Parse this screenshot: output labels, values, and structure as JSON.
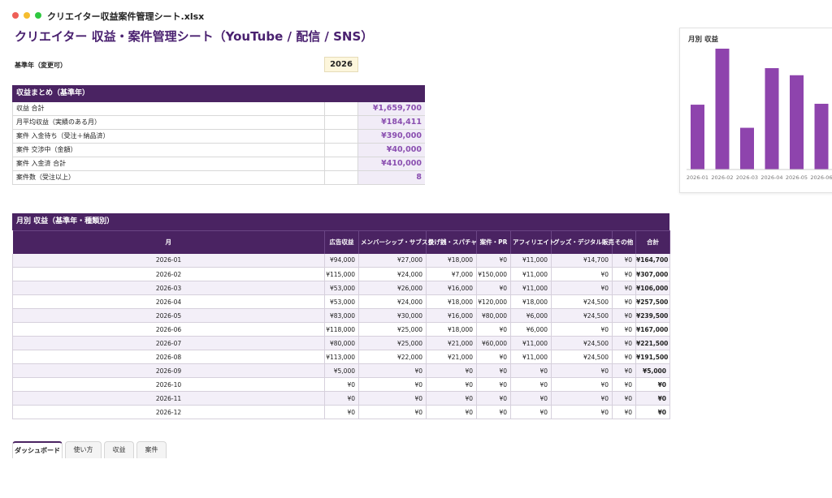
{
  "window": {
    "filename": "クリエイター収益案件管理シート.xlsx"
  },
  "page_title": "クリエイター 収益・案件管理シート（YouTube / 配信 / SNS）",
  "base_year": {
    "label": "基準年（変更可）",
    "value": "2026"
  },
  "summary": {
    "header": "収益まとめ（基準年）",
    "rows": [
      {
        "label": "収益 合計",
        "value": "¥1,659,700"
      },
      {
        "label": "月平均収益（実績のある月）",
        "value": "¥184,411"
      },
      {
        "label": "案件 入金待ち（受注＋納品済）",
        "value": "¥390,000"
      },
      {
        "label": "案件 交渉中（金額）",
        "value": "¥40,000"
      },
      {
        "label": "案件 入金済 合計",
        "value": "¥410,000"
      },
      {
        "label": "案件数（受注以上）",
        "value": "8"
      }
    ]
  },
  "monthly": {
    "header": "月別 収益（基準年・種類別）",
    "columns": [
      "月",
      "広告収益",
      "メンバーシップ・サブスク",
      "投げ銭・スパチャ",
      "案件・PR",
      "アフィリエイト",
      "グッズ・デジタル販売",
      "その他",
      "合計"
    ],
    "rows": [
      [
        "2026-01",
        "¥94,000",
        "¥27,000",
        "¥18,000",
        "¥0",
        "¥11,000",
        "¥14,700",
        "¥0",
        "¥164,700"
      ],
      [
        "2026-02",
        "¥115,000",
        "¥24,000",
        "¥7,000",
        "¥150,000",
        "¥11,000",
        "¥0",
        "¥0",
        "¥307,000"
      ],
      [
        "2026-03",
        "¥53,000",
        "¥26,000",
        "¥16,000",
        "¥0",
        "¥11,000",
        "¥0",
        "¥0",
        "¥106,000"
      ],
      [
        "2026-04",
        "¥53,000",
        "¥24,000",
        "¥18,000",
        "¥120,000",
        "¥18,000",
        "¥24,500",
        "¥0",
        "¥257,500"
      ],
      [
        "2026-05",
        "¥83,000",
        "¥30,000",
        "¥16,000",
        "¥80,000",
        "¥6,000",
        "¥24,500",
        "¥0",
        "¥239,500"
      ],
      [
        "2026-06",
        "¥118,000",
        "¥25,000",
        "¥18,000",
        "¥0",
        "¥6,000",
        "¥0",
        "¥0",
        "¥167,000"
      ],
      [
        "2026-07",
        "¥80,000",
        "¥25,000",
        "¥21,000",
        "¥60,000",
        "¥11,000",
        "¥24,500",
        "¥0",
        "¥221,500"
      ],
      [
        "2026-08",
        "¥113,000",
        "¥22,000",
        "¥21,000",
        "¥0",
        "¥11,000",
        "¥24,500",
        "¥0",
        "¥191,500"
      ],
      [
        "2026-09",
        "¥5,000",
        "¥0",
        "¥0",
        "¥0",
        "¥0",
        "¥0",
        "¥0",
        "¥5,000"
      ],
      [
        "2026-10",
        "¥0",
        "¥0",
        "¥0",
        "¥0",
        "¥0",
        "¥0",
        "¥0",
        "¥0"
      ],
      [
        "2026-11",
        "¥0",
        "¥0",
        "¥0",
        "¥0",
        "¥0",
        "¥0",
        "¥0",
        "¥0"
      ],
      [
        "2026-12",
        "¥0",
        "¥0",
        "¥0",
        "¥0",
        "¥0",
        "¥0",
        "¥0",
        "¥0"
      ]
    ]
  },
  "chart_data": {
    "type": "bar",
    "title": "月別 収益",
    "xlabel": "",
    "ylabel": "",
    "categories": [
      "2026-01",
      "2026-02",
      "2026-03",
      "2026-04",
      "2026-05",
      "2026-06"
    ],
    "values": [
      164700,
      307000,
      106000,
      257500,
      239500,
      167000
    ],
    "ylim": [
      0,
      307000
    ],
    "grid": false,
    "color": "#8e44ad"
  },
  "tabs": [
    {
      "label": "ダッシュボード",
      "active": true
    },
    {
      "label": "使い方",
      "active": false
    },
    {
      "label": "収益",
      "active": false
    },
    {
      "label": "案件",
      "active": false
    }
  ],
  "colors": {
    "header_bg": "#4a2362",
    "title": "#4a2170",
    "value": "#8a4fb0",
    "bar": "#8e44ad"
  }
}
